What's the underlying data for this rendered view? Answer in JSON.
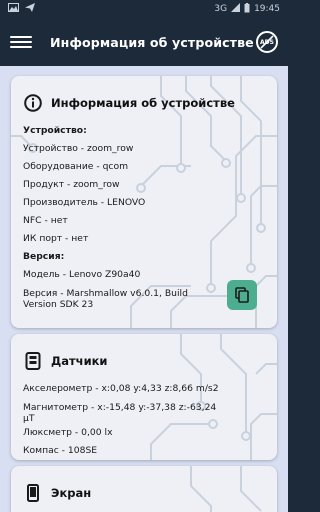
{
  "status_bar": {
    "time": "19:45",
    "signal_text": "3G"
  },
  "app_bar": {
    "title": "Информация об устройстве",
    "noads_badge": "ADS"
  },
  "device_card": {
    "title": "Информация об устройстве",
    "rows": [
      {
        "text": "Устройство:",
        "bold": true
      },
      {
        "text": "Устройство - zoom_row"
      },
      {
        "text": "Оборудование - qcom"
      },
      {
        "text": "Продукт - zoom_row"
      },
      {
        "text": "Производитель - LENOVO"
      },
      {
        "text": "NFC - нет"
      },
      {
        "text": "ИК порт - нет"
      },
      {
        "text": "Версия:",
        "bold": true
      },
      {
        "text": "Модель - Lenovo Z90a40"
      },
      {
        "text": "Версия - Marshmallow v6.0.1, Build Version SDK 23"
      }
    ]
  },
  "sensors_card": {
    "title": "Датчики",
    "rows": [
      {
        "text": "Акселерометр - x:0,08 y:4,33 z:8,66 m/s2"
      },
      {
        "text": "Магнитометр - x:-15,48 y:-37,38 z:-63,24 μT"
      },
      {
        "text": "Люксметр - 0,00 lx"
      },
      {
        "text": "Компас - 108SE"
      }
    ]
  },
  "screen_card": {
    "title": "Экран"
  },
  "colors": {
    "app_bar": "#1c2a3a",
    "content_bg": "#d9dff2",
    "card_bg": "#eef0f6",
    "accent": "#4cae8e",
    "circuit": "#c3ccd9"
  }
}
